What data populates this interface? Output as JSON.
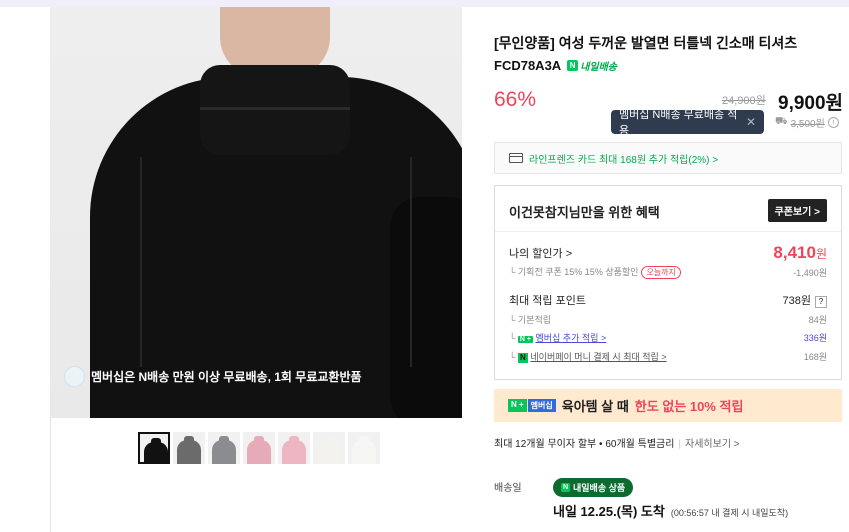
{
  "product": {
    "title": "[무인양품] 여성 두꺼운 발열면 터틀넥 긴소매 티셔츠",
    "code": "FCD78A3A",
    "delivery_badge": "내일배송",
    "discount_rate": "66%",
    "original_price": "24,900원",
    "price": "9,900원"
  },
  "tooltip": {
    "text": "멤버십 N배송 무료배송 적용",
    "close": "✕"
  },
  "shipping_fee": {
    "original": "3,500원"
  },
  "card_offer": "라인프렌즈 카드 최대 168원 추가 적립(2%) >",
  "membership_banner": "멤버십은 N배송 만원 이상 무료배송, 1회 무료교환반품",
  "thumbnails": [
    {
      "color": "#111111"
    },
    {
      "color": "#6b6b6b"
    },
    {
      "color": "#8a8c90"
    },
    {
      "color": "#e7aab8"
    },
    {
      "color": "#eeb5c2"
    },
    {
      "color": "#f4f2ee"
    },
    {
      "color": "#f6f6f4"
    }
  ],
  "benefit": {
    "heading": "이건못참지님만을 위한 혜택",
    "coupon_button": "쿠폰보기 >",
    "my_price_label": "나의 할인가 >",
    "my_price_value": "8,410",
    "my_price_unit": "원",
    "coupon_line": "기획전 쿠폰 15% 15% 상품할인",
    "coupon_tag": "오늘까지",
    "coupon_amount": "-1,490원",
    "max_point_label": "최대 적립 포인트",
    "max_point_value": "738원",
    "max_point_help": "?",
    "basic_label": "기본적립",
    "basic_value": "84원",
    "membership_label": "멤버십 추가 적립 >",
    "membership_value": "336원",
    "npay_label": "네이버페이 머니 결제 시 최대 적립 >",
    "npay_value": "168원",
    "n_plus": "N +",
    "n_pay": "N"
  },
  "promo": {
    "badge1": "N +",
    "badge2": "멤버십",
    "text1": "육아템 살 때",
    "text2": "한도 없는 10% 적립"
  },
  "installment": {
    "text": "최대 12개월 무이자 할부 • 60개월 특별금리",
    "more": "자세히보기 >"
  },
  "delivery": {
    "label": "배송일",
    "badge": "내일배송 상품",
    "date": "내일 12.25.(목) 도착",
    "note": "(00:56:57 내 결제 시 내일도착)"
  }
}
